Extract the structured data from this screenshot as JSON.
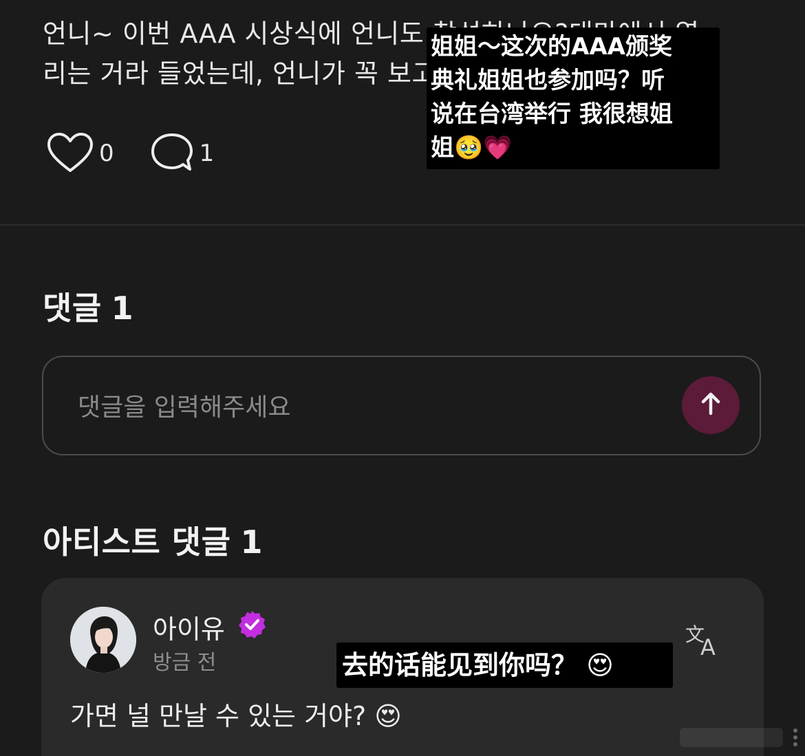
{
  "post": {
    "line1": "언니~ 이번 AAA 시상식에 언니도 참석하나요?대만에서 열",
    "line2": "리는 거라 들었는데, 언니가 꼭 보고 싶어요",
    "likes": "0",
    "comments": "1"
  },
  "comments_section": {
    "title": "댓글",
    "count": "1",
    "input_placeholder": "댓글을 입력해주세요"
  },
  "artist_section": {
    "title": "아티스트 댓글",
    "count": "1",
    "comment": {
      "author": "아이유",
      "time": "방금 전",
      "text": "가면 널 만날 수 있는 거야? 😍"
    }
  },
  "translation_overlays": {
    "post_line1": "姐姐～这次的AAA颁奖",
    "post_line2": "典礼姐姐也参加吗？听",
    "post_line3": "说在台湾举行 我很想姐",
    "post_line4": "姐🥹💗",
    "reply": "去的话能见到你吗？ 😍"
  },
  "icons": {
    "like": "heart-icon",
    "comment": "speech-bubble-icon",
    "send": "arrow-up-icon",
    "verified": "verified-badge-icon",
    "translate": "translate-icon"
  },
  "colors": {
    "background": "#1b1b1b",
    "card": "#2a2a2a",
    "send_button": "#5c1b38",
    "verified": "#c22ee0"
  }
}
